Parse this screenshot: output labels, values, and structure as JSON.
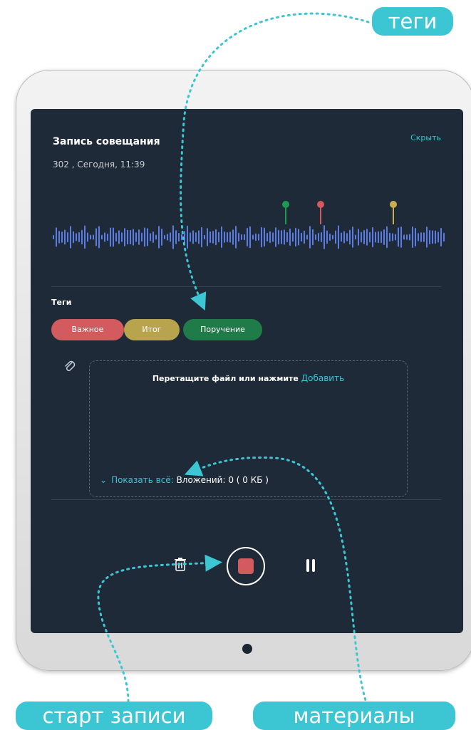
{
  "callouts": {
    "tags": "теги",
    "record_start": "старт записи",
    "materials": "материалы"
  },
  "recording": {
    "title": "Запись совещания",
    "subtitle": "302 , Сегодня, 11:39",
    "hide_link": "Скрыть"
  },
  "tags": {
    "label": "Теги",
    "items": [
      {
        "label": "Важное",
        "color": "#d35a5f"
      },
      {
        "label": "Итог",
        "color": "#b8a44c"
      },
      {
        "label": "Поручение",
        "color": "#1f7b47"
      }
    ]
  },
  "attachments": {
    "drop_text": "Перетащите файл или нажмите",
    "add_link": "Добавить",
    "show_all": "Показать всё:",
    "count_text": "Вложений: 0 ( 0 КБ )"
  },
  "controls": {
    "delete_icon": "trash-icon",
    "record_icon": "stop-record-icon",
    "pause_icon": "pause-icon"
  },
  "colors": {
    "accent": "#3cc6d3",
    "screen_bg": "#1f2a38",
    "waveform": "#5b7ce0"
  }
}
